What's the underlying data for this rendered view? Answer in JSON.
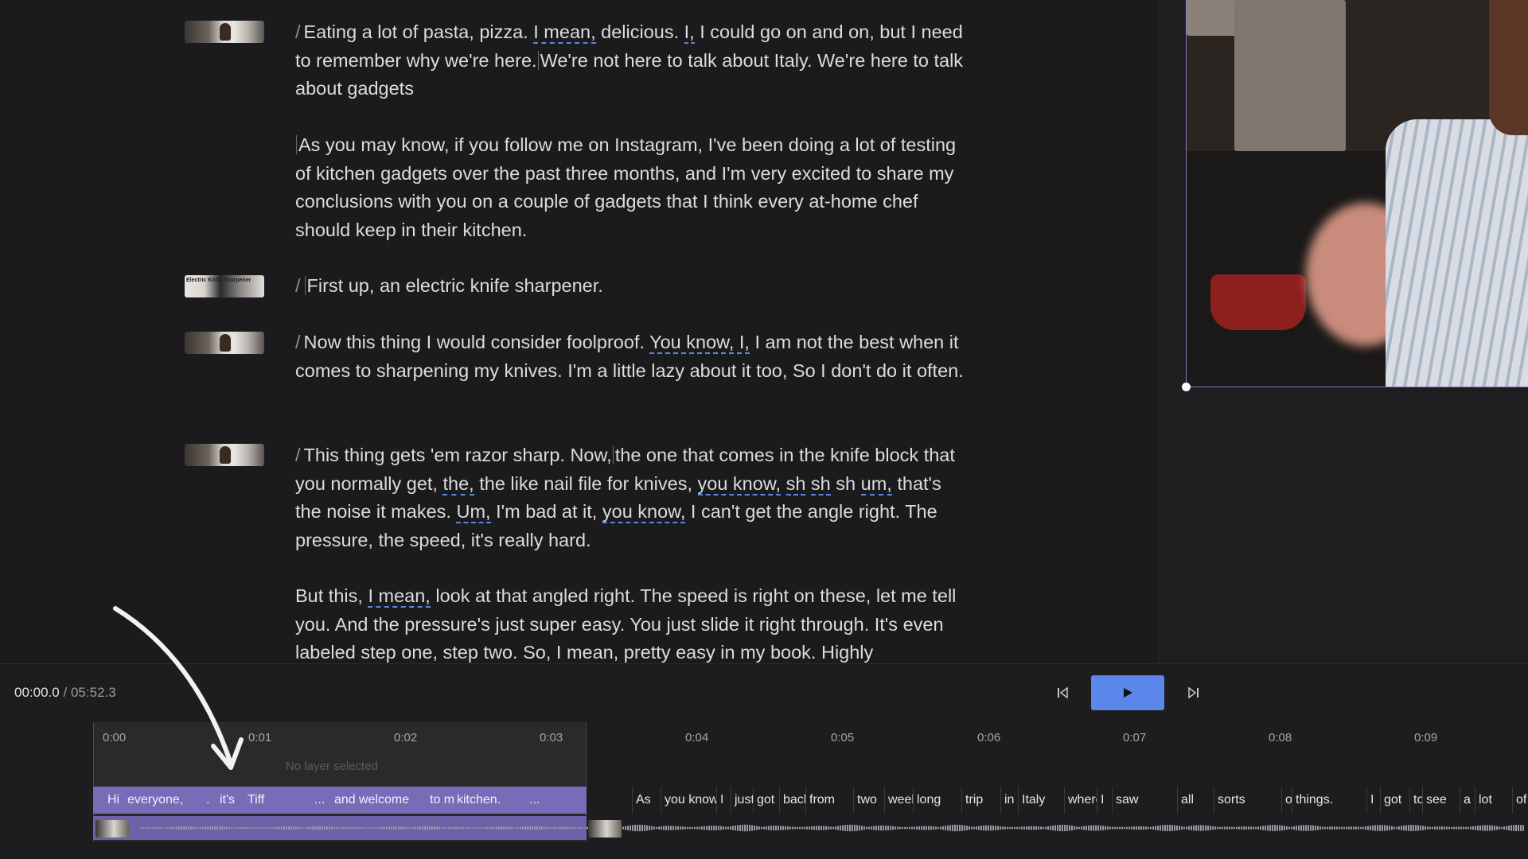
{
  "transcript": {
    "p1": {
      "marker": "/",
      "a": "Eating a lot of pasta, pizza. ",
      "f1": "I mean,",
      "b": " delicious. ",
      "f2": "I,",
      "c": " I could go on and on, but I need to remember why we're here.",
      "d": "We're not here to talk about Italy. We're here to talk about gadgets"
    },
    "p2": {
      "text": "As you may know, if you follow me on Instagram, I've been doing a lot of testing of kitchen gadgets over the past three months, and I'm very excited to share my conclusions with you on a couple of gadgets that I think every at-home chef should keep in their kitchen."
    },
    "p3": {
      "marker": "/",
      "text": "First up, an electric knife sharpener.",
      "thumb_text": "Electric Knife Sharpener"
    },
    "p4": {
      "marker": "/",
      "a": "Now this thing I would consider foolproof. ",
      "f1": "You know, I,",
      "b": " I am not the best when it comes to sharpening my knives. I'm a little lazy about it too, So I don't do it often."
    },
    "p5": {
      "marker": "/",
      "a": "This thing gets 'em razor sharp. Now,",
      "b": "the one that comes in the knife block that you normally get, ",
      "f1": "the,",
      "c": " the like nail file for knives, ",
      "f2": "you know,",
      "f3": "sh",
      "f4": "sh",
      "d": " sh ",
      "f5": "um,",
      "e": " that's the noise it makes. ",
      "f6": "Um,",
      "g": " I'm bad at it, ",
      "f7": "you know,",
      "h": " I can't get the angle right. The pressure, the speed, it's really hard."
    },
    "p6": {
      "a": "But this, ",
      "f1": "I mean,",
      "b": " look at that angled right. The speed is right on these, let me tell you. And the pressure's just super easy. You just slide it right through. It's even labeled step one, step two. So, I mean, pretty easy in my book. Highly"
    }
  },
  "transport": {
    "current_time": "00:00.0",
    "separator": "/",
    "total_time": "05:52.3",
    "prev_icon": "skip-back-icon",
    "play_icon": "play-icon",
    "next_icon": "skip-forward-icon"
  },
  "timeline": {
    "ruler": [
      "0:00",
      "0:01",
      "0:02",
      "0:03",
      "0:04",
      "0:05",
      "0:06",
      "0:07",
      "0:08",
      "0:09"
    ],
    "no_layer_text": "No layer selected",
    "words": [
      {
        "t": "Hi",
        "sel": true
      },
      {
        "t": "everyone,",
        "sel": true
      },
      {
        "t": ".",
        "sel": true
      },
      {
        "t": "it's",
        "sel": true
      },
      {
        "t": "Tiff",
        "sel": true
      },
      {
        "t": "...",
        "sel": true
      },
      {
        "t": "and",
        "sel": true
      },
      {
        "t": "welcome",
        "sel": true
      },
      {
        "t": "to my",
        "sel": true
      },
      {
        "t": "kitchen.",
        "sel": true
      },
      {
        "t": "...",
        "sel": true
      },
      {
        "t": "As"
      },
      {
        "t": "you know"
      },
      {
        "t": "I"
      },
      {
        "t": "just"
      },
      {
        "t": "got"
      },
      {
        "t": "back"
      },
      {
        "t": "from"
      },
      {
        "t": "two"
      },
      {
        "t": "week"
      },
      {
        "t": "long"
      },
      {
        "t": "trip"
      },
      {
        "t": "in"
      },
      {
        "t": "Italy"
      },
      {
        "t": "where"
      },
      {
        "t": "I"
      },
      {
        "t": "saw"
      },
      {
        "t": "all"
      },
      {
        "t": "sorts"
      },
      {
        "t": "of"
      },
      {
        "t": "things."
      },
      {
        "t": "I"
      },
      {
        "t": "got"
      },
      {
        "t": "to"
      },
      {
        "t": "see"
      },
      {
        "t": "a"
      },
      {
        "t": "lot"
      },
      {
        "t": "of"
      }
    ]
  }
}
